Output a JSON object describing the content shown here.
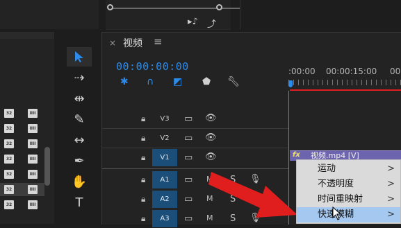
{
  "timeline": {
    "tab_close": "×",
    "tab_title": "视频",
    "tab_menu": "≡",
    "timecode": "00:00:00:00",
    "ruler_labels": [
      ":00:00",
      "00:00:15:00",
      "00"
    ]
  },
  "tracks": [
    {
      "name": "V3",
      "active": false,
      "mid": ""
    },
    {
      "name": "V2",
      "active": false,
      "mid": ""
    },
    {
      "name": "V1",
      "active": true,
      "mid": ""
    },
    {
      "name": "A1",
      "active": true,
      "mid": "M"
    },
    {
      "name": "A2",
      "active": true,
      "mid": "M"
    },
    {
      "name": "A3",
      "active": true,
      "mid": "M"
    }
  ],
  "clip": {
    "fx": "fx",
    "name": "视频.mp4 [V]"
  },
  "context_menu": {
    "items": [
      {
        "label": "运动",
        "arrow": ">"
      },
      {
        "label": "不透明度",
        "arrow": ">"
      },
      {
        "label": "时间重映射",
        "arrow": ">"
      },
      {
        "label": "快速模糊",
        "arrow": ">",
        "highlighted": true
      }
    ]
  },
  "project_panel": {
    "thumb_label": "IIII"
  },
  "colors": {
    "accent": "#2d8ceb",
    "track_active": "#1b4f79",
    "clip": "#6d64b0",
    "menu_highlight": "#a4c8ef",
    "annotation_arrow": "#e01e1e"
  }
}
